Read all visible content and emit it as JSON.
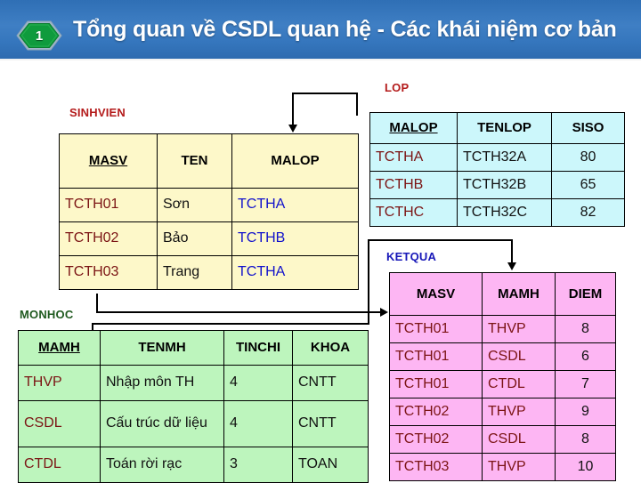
{
  "banner": {
    "badge_number": "1",
    "title": "Tổng quan về CSDL quan hệ - Các khái niệm cơ bản",
    "accent_color": "#3576bd",
    "badge_color": "#0f9b3d"
  },
  "diagram": {
    "kind": "relational-schema",
    "tables": [
      {
        "name": "SINHVIEN",
        "caption_color": "#b41b1b",
        "fill_color": "#fdf8c9",
        "primary_key": "MASV",
        "columns": [
          "MASV",
          "TEN",
          "MALOP"
        ],
        "rows": [
          [
            "TCTH01",
            "Sơn",
            "TCTHA"
          ],
          [
            "TCTH02",
            "Bảo",
            "TCTHB"
          ],
          [
            "TCTH03",
            "Trang",
            "TCTHA"
          ]
        ]
      },
      {
        "name": "LOP",
        "caption_color": "#b41b1b",
        "fill_color": "#ccf7fb",
        "primary_key": "MALOP",
        "columns": [
          "MALOP",
          "TENLOP",
          "SISO"
        ],
        "rows": [
          [
            "TCTHA",
            "TCTH32A",
            "80"
          ],
          [
            "TCTHB",
            "TCTH32B",
            "65"
          ],
          [
            "TCTHC",
            "TCTH32C",
            "82"
          ]
        ]
      },
      {
        "name": "MONHOC",
        "caption_color": "#1f5a1f",
        "fill_color": "#bdf5bd",
        "primary_key": "MAMH",
        "columns": [
          "MAMH",
          "TENMH",
          "TINCHI",
          "KHOA"
        ],
        "rows": [
          [
            "THVP",
            "Nhập môn TH",
            "4",
            "CNTT"
          ],
          [
            "CSDL",
            "Cấu trúc dữ liệu",
            "4",
            "CNTT"
          ],
          [
            "CTDL",
            "Toán rời rạc",
            "3",
            "TOAN"
          ]
        ]
      },
      {
        "name": "KETQUA",
        "caption_color": "#1717b8",
        "fill_color": "#fdb6f3",
        "primary_key": "",
        "columns": [
          "MASV",
          "MAMH",
          "DIEM"
        ],
        "rows": [
          [
            "TCTH01",
            "THVP",
            "8"
          ],
          [
            "TCTH01",
            "CSDL",
            "6"
          ],
          [
            "TCTH01",
            "CTDL",
            "7"
          ],
          [
            "TCTH02",
            "THVP",
            "9"
          ],
          [
            "TCTH02",
            "CSDL",
            "8"
          ],
          [
            "TCTH03",
            "THVP",
            "10"
          ]
        ]
      }
    ],
    "relationships": [
      {
        "from": "LOP.MALOP",
        "to": "SINHVIEN.MALOP"
      },
      {
        "from": "SINHVIEN.MASV",
        "to": "KETQUA.MASV"
      },
      {
        "from": "MONHOC.MAMH",
        "to": "KETQUA.MAMH"
      }
    ]
  }
}
